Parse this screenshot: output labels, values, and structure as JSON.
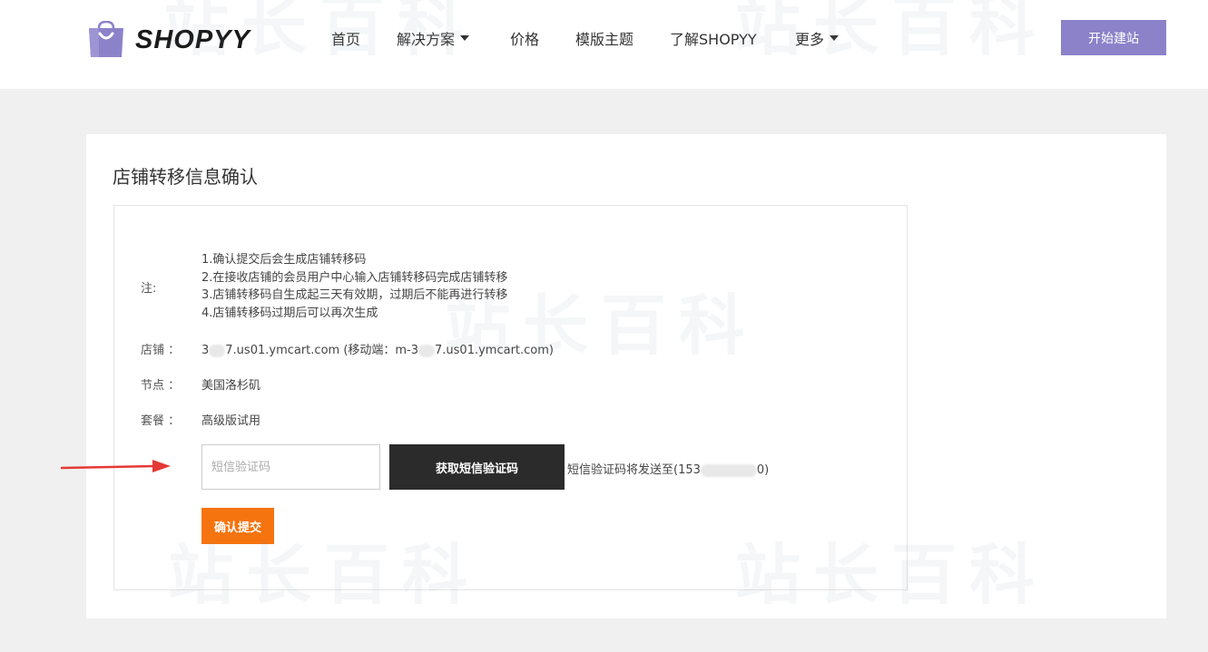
{
  "header": {
    "logo_text": "SHOPYY",
    "nav": [
      {
        "label": "首页",
        "has_caret": false
      },
      {
        "label": "解决方案",
        "has_caret": true
      },
      {
        "label": "价格",
        "has_caret": false
      },
      {
        "label": "模版主题",
        "has_caret": false
      },
      {
        "label": "了解SHOPYY",
        "has_caret": false
      },
      {
        "label": "更多",
        "has_caret": true
      }
    ],
    "cta_label": "开始建站"
  },
  "watermark": {
    "text": "站长百科"
  },
  "card": {
    "title": "店铺转移信息确认",
    "notes_label": "注:",
    "notes": [
      "1.确认提交后会生成店铺转移码",
      "2.在接收店铺的会员用户中心输入店铺转移码完成店铺转移",
      "3.店铺转移码自生成起三天有效期，过期后不能再进行转移",
      "4.店铺转移码过期后可以再次生成"
    ],
    "store": {
      "label": "店铺 ：",
      "value_prefix": "3",
      "value_mid": "7.us01.ymcart.com (移动端：m-3",
      "value_suffix": "7.us01.ymcart.com)"
    },
    "node": {
      "label": "节点 ：",
      "value": "美国洛杉矶"
    },
    "plan": {
      "label": "套餐 ：",
      "value": "高级版试用"
    },
    "sms": {
      "placeholder": "短信验证码",
      "get_code_label": "获取短信验证码",
      "note_prefix": "短信验证码将发送至(153",
      "note_suffix": "0)"
    },
    "submit_label": "确认提交"
  },
  "colors": {
    "brand_purple": "#8c82c9",
    "submit_orange": "#f5740f",
    "dark_button": "#2b2b2b",
    "arrow_red": "#e53935"
  }
}
